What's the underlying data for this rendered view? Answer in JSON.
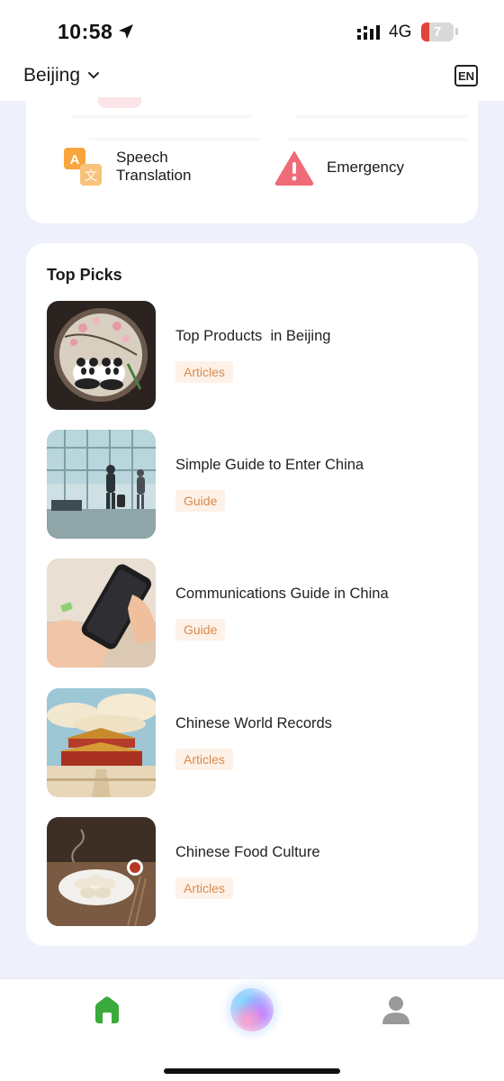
{
  "status_bar": {
    "time": "10:58",
    "network": "4G",
    "battery": "7",
    "icons": [
      "location-arrow-icon",
      "signal-icon",
      "battery-icon"
    ]
  },
  "header": {
    "city": "Beijing",
    "language": "EN"
  },
  "services": [
    {
      "label_line1": "Speech",
      "label_line2": "Translation",
      "icon": "translate-icon"
    },
    {
      "label_line1": "Emergency",
      "icon": "warning-icon"
    }
  ],
  "top_picks": {
    "title": "Top Picks",
    "items": [
      {
        "title": "Top Products  in Beijing",
        "tag": "Articles",
        "image": "panda-embroidery-image"
      },
      {
        "title": "Simple Guide to Enter China",
        "tag": "Guide",
        "image": "airport-travelers-image"
      },
      {
        "title": "Communications Guide in China",
        "tag": "Guide",
        "image": "phone-sim-card-image"
      },
      {
        "title": "Chinese World Records",
        "tag": "Articles",
        "image": "forbidden-city-image"
      },
      {
        "title": "Chinese Food Culture",
        "tag": "Articles",
        "image": "dumplings-image"
      }
    ]
  },
  "tab_bar": {
    "tabs": [
      "home-icon",
      "ai-assistant-orb",
      "profile-icon"
    ]
  },
  "colors": {
    "accent_green": "#3aaa3a",
    "tag_bg": "#fdf1e8",
    "tag_text": "#d98b4c",
    "warning": "#ef6b78",
    "translate_orange": "#f7a53c"
  }
}
